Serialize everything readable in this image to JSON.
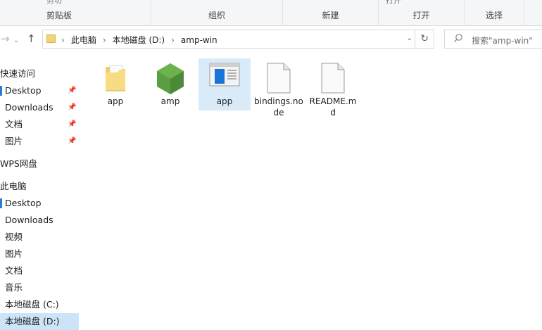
{
  "ribbon": {
    "groups": [
      {
        "label": "剪贴板",
        "top_cut": "剪切"
      },
      {
        "label": "组织",
        "top_cut": ""
      },
      {
        "label": "新建",
        "top_cut": ""
      },
      {
        "label": "打开",
        "top_cut": "打开"
      },
      {
        "label": "选择",
        "top_cut": ""
      }
    ]
  },
  "address": {
    "crumbs": [
      "此电脑",
      "本地磁盘 (D:)",
      "amp-win"
    ]
  },
  "search": {
    "placeholder": "搜索\"amp-win\""
  },
  "sidebar": {
    "items": [
      {
        "label": "快速访问"
      },
      {
        "label": "Desktop"
      },
      {
        "label": "Downloads"
      },
      {
        "label": "文档"
      },
      {
        "label": "图片"
      },
      {
        "label": "WPS网盘"
      },
      {
        "label": "此电脑"
      },
      {
        "label": "Desktop"
      },
      {
        "label": "Downloads"
      },
      {
        "label": "视频"
      },
      {
        "label": "图片"
      },
      {
        "label": "文档"
      },
      {
        "label": "音乐"
      },
      {
        "label": "本地磁盘 (C:)"
      },
      {
        "label": "本地磁盘 (D:)"
      }
    ]
  },
  "files": [
    {
      "name": "app",
      "icon": "folder-icon"
    },
    {
      "name": "amp",
      "icon": "nodejs-icon"
    },
    {
      "name": "app",
      "icon": "application-icon"
    },
    {
      "name": "bindings.node",
      "icon": "file-icon"
    },
    {
      "name": "README.md",
      "icon": "file-icon"
    }
  ],
  "colors": {
    "accent": "#2a7bd4",
    "selection": "#d9ebf9",
    "sidebar_selection": "#cce4f7"
  }
}
